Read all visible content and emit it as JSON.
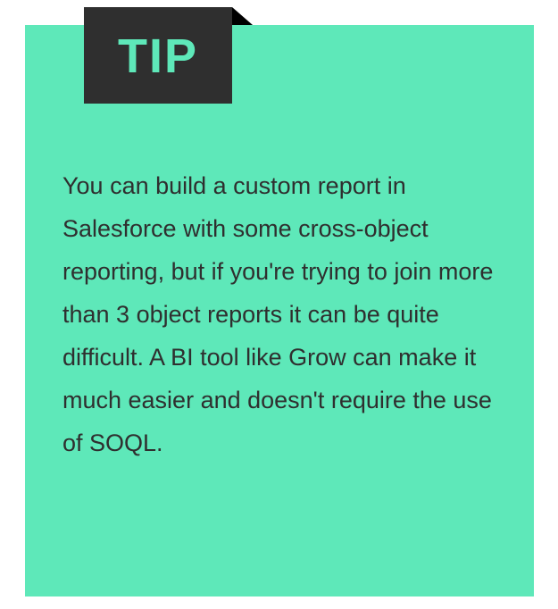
{
  "tip_card": {
    "badge_label": "TIP",
    "body": "You can build a custom report in Salesforce with some cross-object reporting, but if you're trying to join more than 3 object reports it can be quite difficult. A BI tool like Grow can make it much easier and doesn't require the use of SOQL."
  }
}
